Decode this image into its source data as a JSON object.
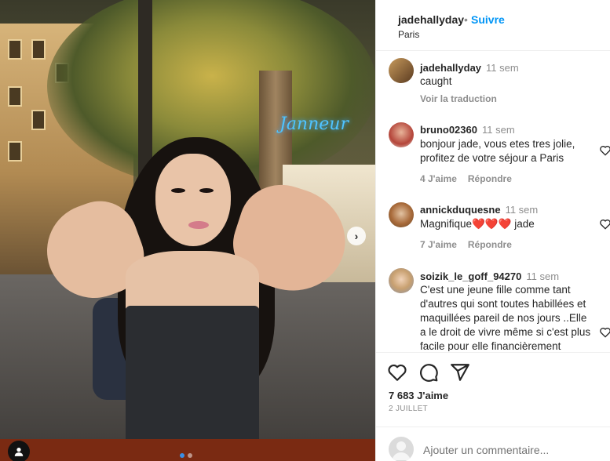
{
  "post": {
    "username": "jadehallyday",
    "separator": "•",
    "follow_label": "Suivre",
    "location": "Paris",
    "neon_sign": "Janneur"
  },
  "comments": [
    {
      "username": "jadehallyday",
      "time": "11 sem",
      "text": "caught",
      "meta": [
        "Voir la traduction"
      ]
    },
    {
      "username": "bruno02360",
      "time": "11 sem",
      "text": "bonjour jade, vous etes tres jolie, profitez de votre séjour a Paris",
      "meta": [
        "4 J'aime",
        "Répondre"
      ]
    },
    {
      "username": "annickduquesne",
      "time": "11 sem",
      "text_before": "Magnifique",
      "hearts": "❤️❤️❤️",
      "text_after": "jade",
      "meta": [
        "7 J'aime",
        "Répondre"
      ]
    },
    {
      "username": "soizik_le_goff_94270",
      "time": "11 sem",
      "text": "C'est une jeune fille comme tant d'autres qui sont toutes habillées et maquillées pareil de nos jours ..Elle a le droit de vivre même si c'est plus facile pour elle financièrement",
      "meta": []
    }
  ],
  "actions": {
    "likes": "7 683 J'aime",
    "date": "2 JUILLET",
    "comment_placeholder": "Ajouter un commentaire..."
  },
  "icons": {
    "like": "heart-icon",
    "comment": "comment-icon",
    "share": "share-icon",
    "next": "chevron-right-icon",
    "tag": "user-tag-icon",
    "comment_like": "heart-small-icon"
  },
  "colors": {
    "accent": "#0095f6",
    "text": "#262626",
    "muted": "#8e8e8e",
    "heart": "#ed1c24"
  }
}
